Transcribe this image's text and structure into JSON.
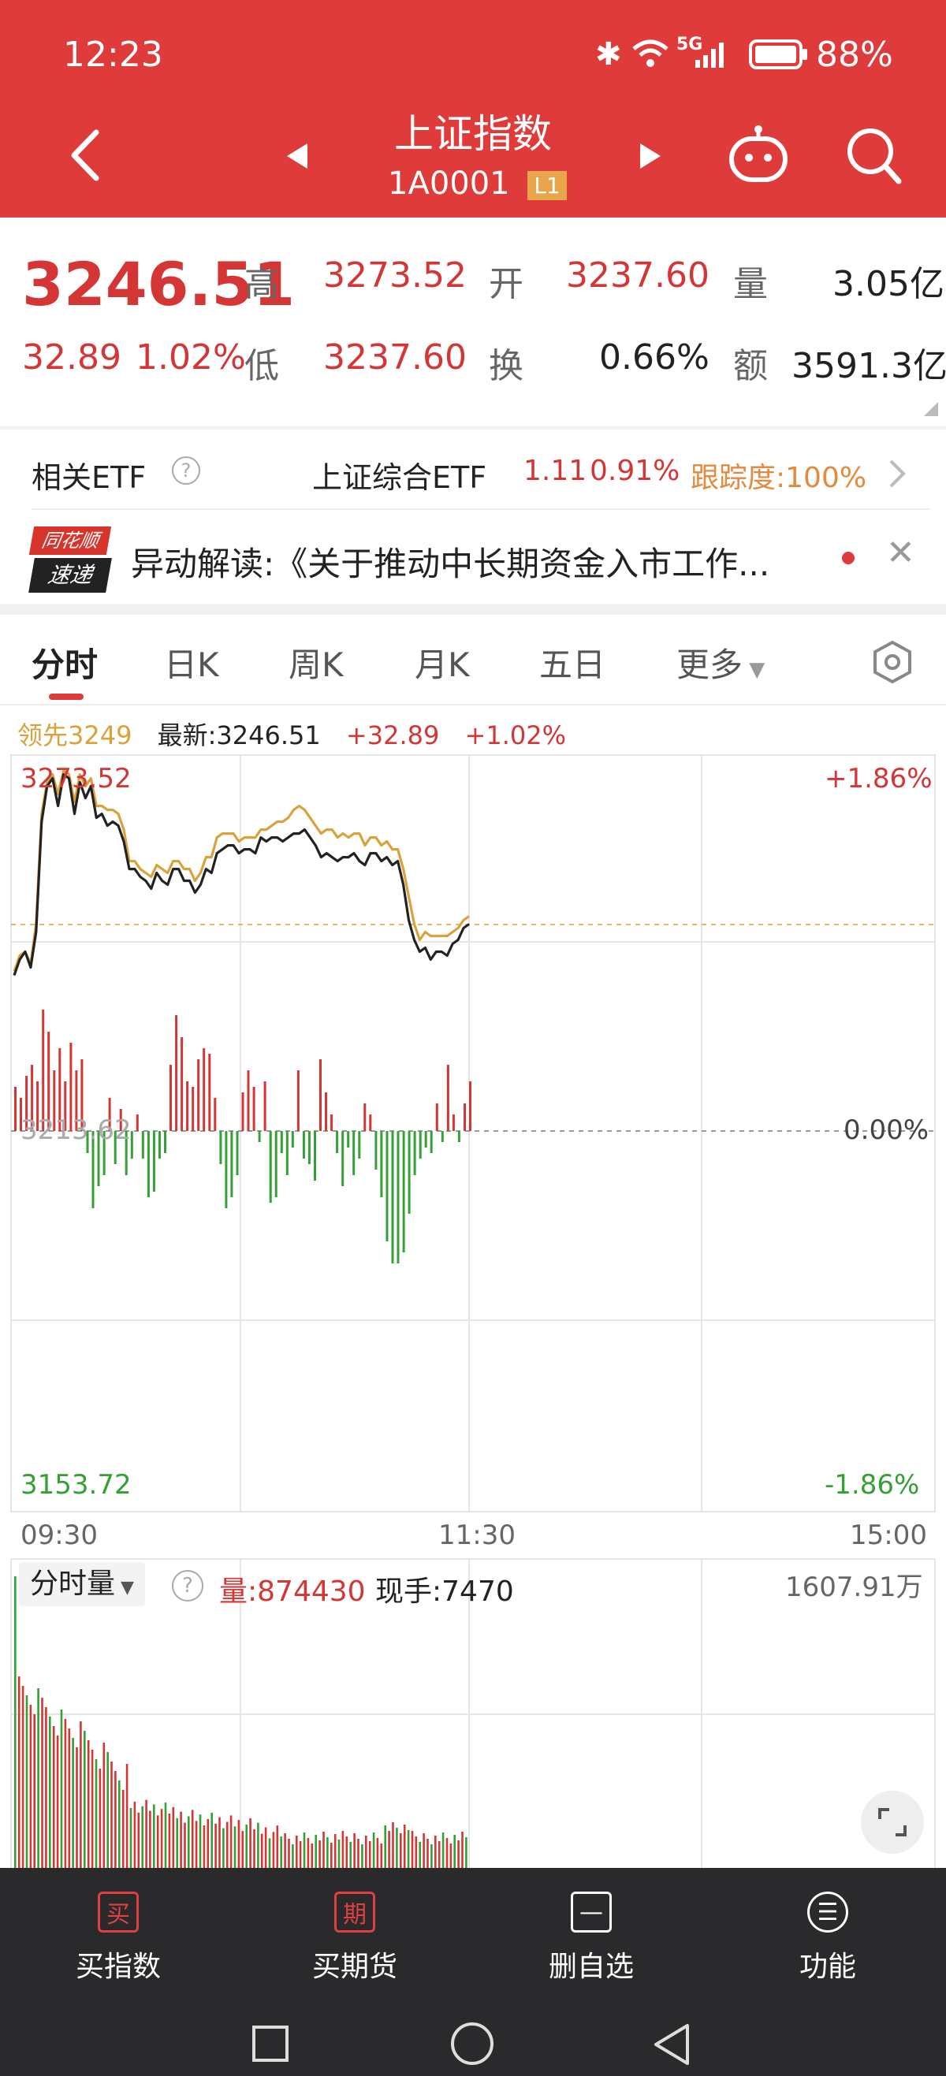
{
  "status": {
    "time": "12:23",
    "signal": "5G",
    "battery": "88%"
  },
  "header": {
    "title": "上证指数",
    "code": "1A0001",
    "level_badge": "L1"
  },
  "quote": {
    "price": "3246.51",
    "change": "32.89",
    "change_pct": "1.02%",
    "high_label": "高",
    "high": "3273.52",
    "open_label": "开",
    "open": "3237.60",
    "volume_label": "量",
    "volume": "3.05亿",
    "low_label": "低",
    "low": "3237.60",
    "turnover_label": "换",
    "turnover": "0.66%",
    "amount_label": "额",
    "amount": "3591.3亿"
  },
  "etf": {
    "label": "相关ETF",
    "name": "上证综合ETF",
    "price": "1.11",
    "pct": "0.91%",
    "tracking": "跟踪度:100%"
  },
  "news": {
    "logo_top": "同花顺",
    "logo_bottom": "速递",
    "text": "异动解读:《关于推动中长期资金入市工作..."
  },
  "tabs": [
    "分时",
    "日K",
    "周K",
    "月K",
    "五日",
    "更多"
  ],
  "info": {
    "lead": "领先3249",
    "latest": "最新:3246.51",
    "chg": "+32.89",
    "pct": "+1.02%"
  },
  "price_axis": {
    "top": "3273.52",
    "top_pct": "+1.86%",
    "mid": "3213.62",
    "mid_pct": "0.00%",
    "bottom": "3153.72",
    "bottom_pct": "-1.86%"
  },
  "time_axis": [
    "09:30",
    "11:30",
    "15:00"
  ],
  "volume_panel": {
    "selector": "分时量",
    "vol": "量:874430",
    "hand": "现手:7470",
    "max": "1607.91万"
  },
  "bottom_nav": [
    {
      "label": "买指数",
      "icon": "买"
    },
    {
      "label": "买期货",
      "icon": "期"
    },
    {
      "label": "删自选",
      "icon": "—"
    },
    {
      "label": "功能",
      "icon": "☰"
    }
  ],
  "colors": {
    "up": "#d43535",
    "down": "#35a035",
    "header": "#e03b3b",
    "lead": "#d9a23b",
    "line": "#222222"
  },
  "chart_data": {
    "type": "line",
    "yaxis_ticks": [
      "3273.52",
      "3213.62",
      "3153.72"
    ],
    "ylim": [
      3153.72,
      3273.52
    ],
    "xlabel_ticks": [
      "09:30",
      "11:30",
      "15:00"
    ],
    "series": [
      {
        "name": "最新",
        "values": [
          3220,
          3224,
          3226,
          3222,
          3231,
          3259,
          3268,
          3270,
          3263,
          3271,
          3270,
          3261,
          3269,
          3265,
          3268,
          3260,
          3261,
          3258,
          3259,
          3258,
          3254,
          3247,
          3247,
          3245,
          3244,
          3242,
          3246,
          3244,
          3243,
          3247,
          3247,
          3244,
          3244,
          3241,
          3243,
          3247,
          3246,
          3251,
          3252,
          3253,
          3253,
          3251,
          3252,
          3252,
          3251,
          3255,
          3254,
          3255,
          3255,
          3254,
          3255,
          3256,
          3256,
          3257,
          3255,
          3253,
          3250,
          3251,
          3250,
          3249,
          3250,
          3250,
          3251,
          3249,
          3248,
          3251,
          3251,
          3249,
          3250,
          3248,
          3249,
          3243,
          3234,
          3229,
          3226,
          3227,
          3224,
          3226,
          3226,
          3225,
          3228,
          3229,
          3232,
          3233
        ]
      },
      {
        "name": "领先",
        "values": [
          3221,
          3225,
          3226,
          3223,
          3233,
          3261,
          3269,
          3271,
          3266,
          3272,
          3271,
          3264,
          3271,
          3268,
          3270,
          3263,
          3263,
          3262,
          3262,
          3261,
          3257,
          3249,
          3249,
          3247,
          3246,
          3245,
          3248,
          3247,
          3246,
          3249,
          3249,
          3247,
          3247,
          3244,
          3246,
          3250,
          3250,
          3255,
          3256,
          3256,
          3256,
          3254,
          3255,
          3255,
          3255,
          3257,
          3257,
          3258,
          3259,
          3259,
          3260,
          3262,
          3263,
          3262,
          3260,
          3258,
          3256,
          3257,
          3257,
          3255,
          3256,
          3255,
          3256,
          3256,
          3253,
          3255,
          3255,
          3253,
          3254,
          3252,
          3252,
          3247,
          3240,
          3233,
          3229,
          3231,
          3230,
          3230,
          3230,
          3230,
          3231,
          3232,
          3234,
          3235
        ]
      }
    ],
    "macd": [
      8,
      6,
      10,
      12,
      9,
      22,
      18,
      11,
      15,
      9,
      16,
      11,
      13,
      -4,
      -14,
      -10,
      -8,
      6,
      -6,
      4,
      -8,
      -5,
      3,
      -5,
      -12,
      -11,
      -5,
      -4,
      12,
      21,
      17,
      9,
      8,
      13,
      15,
      14,
      6,
      -6,
      -14,
      -12,
      -8,
      7,
      11,
      8,
      -2,
      9,
      -13,
      -12,
      -4,
      -8,
      -3,
      11,
      -5,
      -6,
      -9,
      13,
      7,
      3,
      -4,
      -10,
      -3,
      -8,
      -5,
      5,
      3,
      -7,
      -12,
      -20,
      -24,
      -24,
      -22,
      -15,
      -8,
      -5,
      -3,
      -4,
      5,
      -2,
      12,
      3,
      -2,
      5,
      9
    ]
  }
}
